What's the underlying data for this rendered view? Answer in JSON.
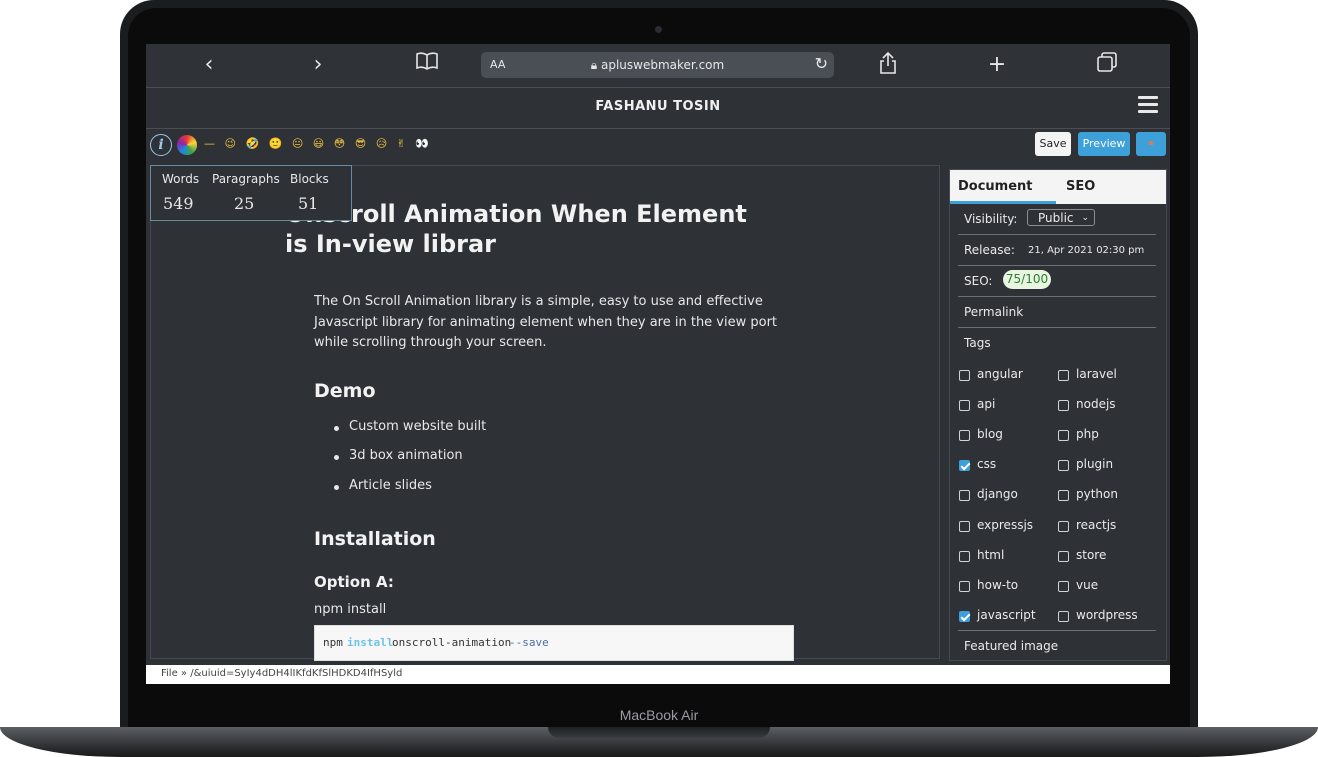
{
  "browser": {
    "aa_label": "AA",
    "host": "apluswebmaker.com"
  },
  "app": {
    "title": "FASHANU TOSIN"
  },
  "toolbar": {
    "save_label": "Save",
    "preview_label": "Preview",
    "emojis": "— 😉 🤣 🙂 😐 😃 😳 😎 😥 ✌ 👀"
  },
  "stats": {
    "words_label": "Words",
    "words": "549",
    "paragraphs_label": "Paragraphs",
    "paragraphs": "25",
    "blocks_label": "Blocks",
    "blocks": "51"
  },
  "document": {
    "title_line1": "Onscroll Animation When Element",
    "title_line2": "is In-view librar",
    "intro": "The On Scroll Animation library is a simple, easy to use and effective Javascript library for animating element when they are in the view port while scrolling through your screen.",
    "demo_heading": "Demo",
    "demo_items": [
      "Custom website built",
      "3d box animation",
      "Article slides"
    ],
    "install_heading": "Installation",
    "option_a": "Option A:",
    "npm_label": "npm install",
    "code": {
      "cmd": "npm",
      "keyword": "install",
      "pkg": "onscroll-animation",
      "flag": "--save"
    }
  },
  "sidebar": {
    "tab_document": "Document",
    "tab_seo": "SEO",
    "visibility_label": "Visibility:",
    "visibility_value": "Public",
    "release_label": "Release:",
    "release_value": "21, Apr 2021 02:30 pm",
    "seo_label": "SEO:",
    "seo_value": "75/100",
    "permalink_label": "Permalink",
    "tags_label": "Tags",
    "tags_left": [
      {
        "name": "angular",
        "checked": false
      },
      {
        "name": "api",
        "checked": false
      },
      {
        "name": "blog",
        "checked": false
      },
      {
        "name": "css",
        "checked": true
      },
      {
        "name": "django",
        "checked": false
      },
      {
        "name": "expressjs",
        "checked": false
      },
      {
        "name": "html",
        "checked": false
      },
      {
        "name": "how-to",
        "checked": false
      },
      {
        "name": "javascript",
        "checked": true
      }
    ],
    "tags_right": [
      {
        "name": "laravel",
        "checked": false
      },
      {
        "name": "nodejs",
        "checked": false
      },
      {
        "name": "php",
        "checked": false
      },
      {
        "name": "plugin",
        "checked": false
      },
      {
        "name": "python",
        "checked": false
      },
      {
        "name": "reactjs",
        "checked": false
      },
      {
        "name": "store",
        "checked": false
      },
      {
        "name": "vue",
        "checked": false
      },
      {
        "name": "wordpress",
        "checked": false
      }
    ],
    "featured_label": "Featured image"
  },
  "status": {
    "path": "File » /&uiuid=SyIy4dDH4lIKfdKfSlHDKD4IfHSyld"
  },
  "device": {
    "label": "MacBook Air"
  }
}
